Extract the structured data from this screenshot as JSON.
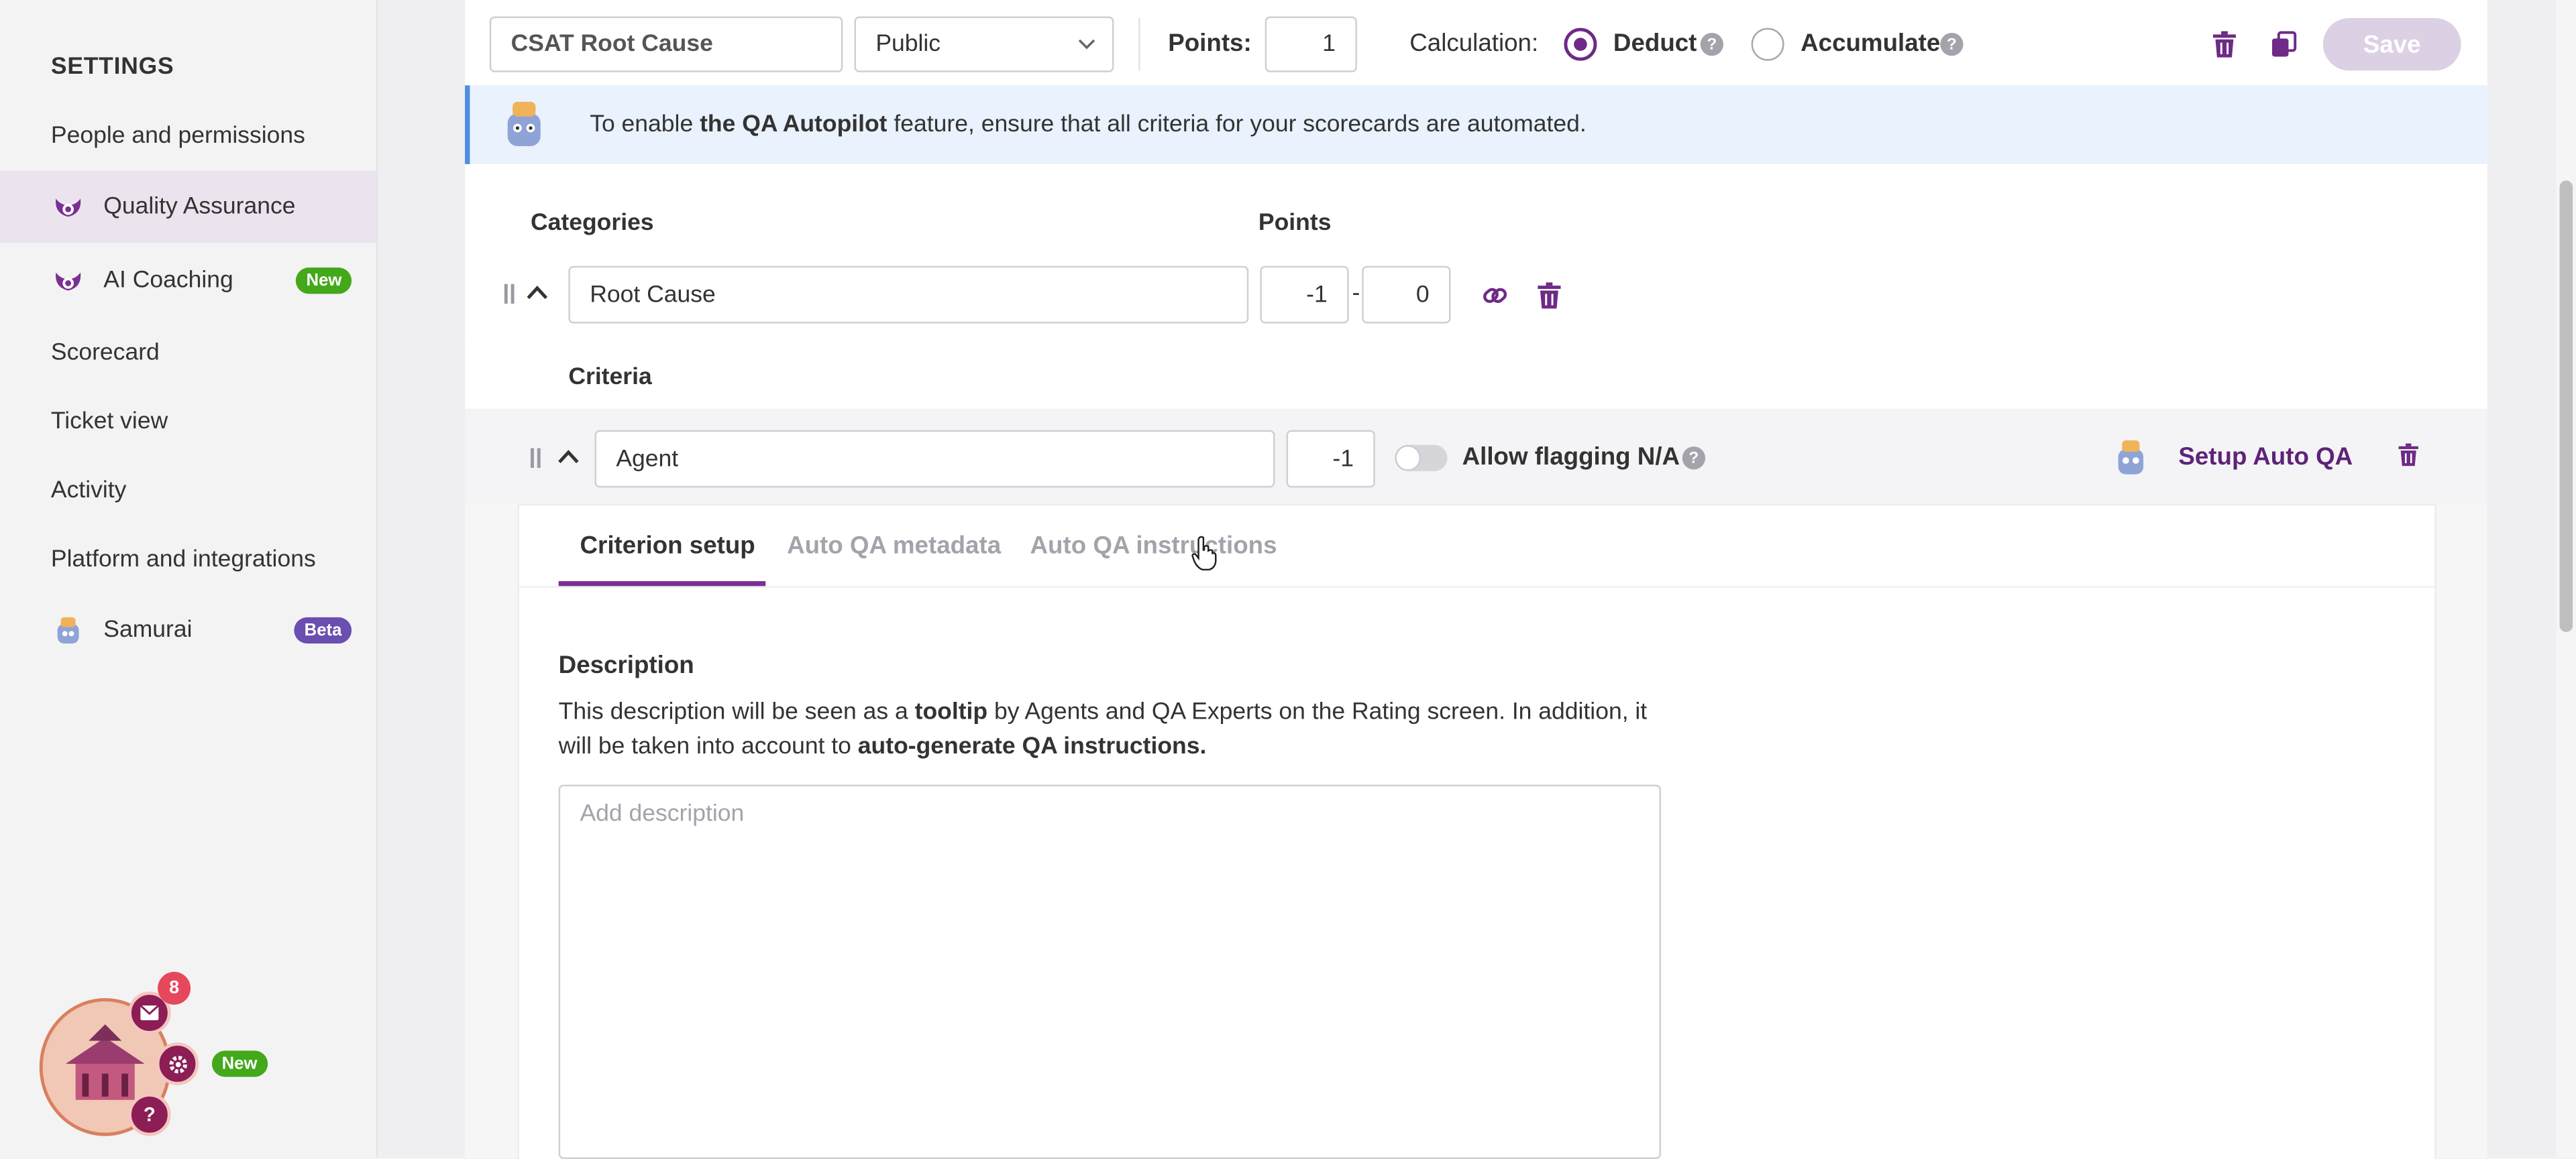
{
  "sidebar": {
    "heading": "SETTINGS",
    "items": [
      {
        "label": "People and permissions"
      },
      {
        "label": "Quality Assurance",
        "icon": "qa-logo-icon",
        "active": true
      },
      {
        "label": "AI Coaching",
        "icon": "qa-logo-icon",
        "badge": "New"
      },
      {
        "label": "Scorecard"
      },
      {
        "label": "Ticket view"
      },
      {
        "label": "Activity"
      },
      {
        "label": "Platform and integrations"
      },
      {
        "label": "Samurai",
        "icon": "samurai-avatar-icon",
        "badge": "Beta"
      }
    ]
  },
  "widget": {
    "notification_count": "8",
    "new_label": "New",
    "help_glyph": "?"
  },
  "toolbar": {
    "scorecard_name": "CSAT Root Cause",
    "visibility": "Public",
    "points_label": "Points:",
    "points_value": "1",
    "calculation_label": "Calculation:",
    "deduct_label": "Deduct",
    "accumulate_label": "Accumulate",
    "help_glyph": "?",
    "save_label": "Save"
  },
  "banner": {
    "prefix": "To enable ",
    "bold": "the QA Autopilot",
    "suffix": " feature, ensure that all criteria for your scorecards are automated."
  },
  "categories": {
    "header_label": "Categories",
    "points_header": "Points",
    "items": [
      {
        "name": "Root Cause",
        "min": "-1",
        "separator": "-",
        "max": "0"
      }
    ]
  },
  "criteria": {
    "header_label": "Criteria",
    "items": [
      {
        "name": "Agent",
        "points": "-1",
        "allow_na_label": "Allow flagging N/A",
        "setup_label": "Setup Auto QA"
      }
    ]
  },
  "criterion_card": {
    "tabs": [
      "Criterion setup",
      "Auto QA metadata",
      "Auto QA instructions"
    ],
    "active_tab": 0,
    "description_title": "Description",
    "description_parts": {
      "t1": "This description will be seen as a ",
      "b1": "tooltip",
      "t2": " by Agents and QA Experts on the Rating screen. In addition, it will be taken into account to ",
      "b2": "auto-generate QA instructions."
    },
    "description_placeholder": "Add description"
  },
  "colors": {
    "accent": "#6e2a86",
    "new_badge": "#43a81a",
    "beta_badge": "#6a4eb0",
    "banner_bg": "#e9f2fd",
    "notif": "#e6485b"
  }
}
